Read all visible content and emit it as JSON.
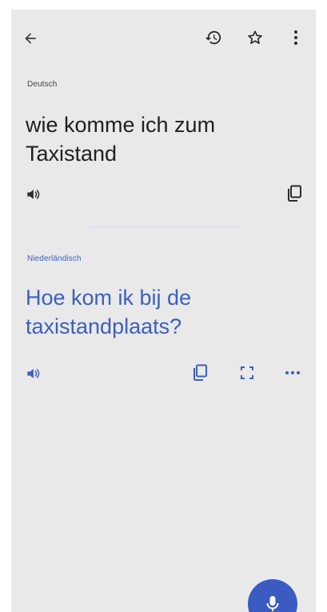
{
  "source": {
    "language": "Deutsch",
    "text": "wie komme ich zum Taxistand"
  },
  "target": {
    "language": "Niederländisch",
    "text": "Hoe kom ik bij de taxistandplaats?"
  },
  "icons": {
    "back": "arrow-left-icon",
    "history": "history-icon",
    "star": "star-icon",
    "menu": "more-vert-icon",
    "speaker": "speaker-icon",
    "copy": "copy-icon",
    "fullscreen": "fullscreen-icon",
    "more": "more-horiz-icon",
    "mic": "mic-icon"
  },
  "colors": {
    "background": "#e9e9e9",
    "accent": "#3b5bc2",
    "translation_text": "#3c5fc0"
  }
}
